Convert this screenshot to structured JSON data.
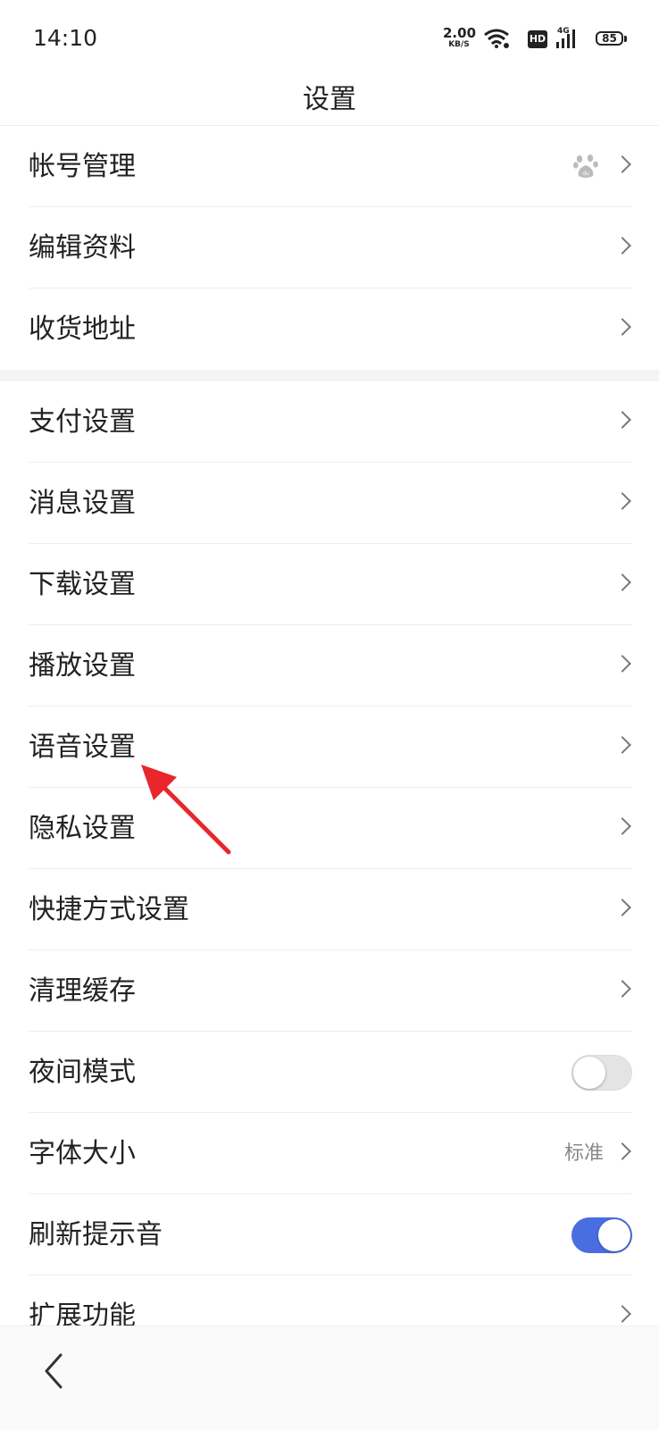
{
  "status_bar": {
    "time": "14:10",
    "net_speed_value": "2.00",
    "net_speed_unit": "KB/S",
    "hd_label": "HD",
    "cell_label": "4G",
    "battery": "85",
    "icons": [
      "wifi-icon",
      "cell-signal-icon",
      "battery-icon"
    ]
  },
  "header": {
    "title": "设置"
  },
  "sections": [
    {
      "items": [
        {
          "label": "帐号管理",
          "trailing_icon": "baidu-paw-icon",
          "chevron": true
        },
        {
          "label": "编辑资料",
          "chevron": true
        },
        {
          "label": "收货地址",
          "chevron": true
        }
      ]
    },
    {
      "items": [
        {
          "label": "支付设置",
          "chevron": true
        },
        {
          "label": "消息设置",
          "chevron": true
        },
        {
          "label": "下载设置",
          "chevron": true
        },
        {
          "label": "播放设置",
          "chevron": true
        },
        {
          "label": "语音设置",
          "chevron": true
        },
        {
          "label": "隐私设置",
          "chevron": true
        },
        {
          "label": "快捷方式设置",
          "chevron": true
        },
        {
          "label": "清理缓存",
          "chevron": true
        },
        {
          "label": "夜间模式",
          "toggle": false
        },
        {
          "label": "字体大小",
          "value": "标准",
          "chevron": true
        },
        {
          "label": "刷新提示音",
          "toggle": true
        },
        {
          "label": "扩展功能",
          "chevron": true
        }
      ]
    }
  ],
  "colors": {
    "toggle_on": "#4a6ee0",
    "toggle_off": "#e4e4e4",
    "annotation_arrow": "#e8262b",
    "divider": "#eeeeee"
  },
  "bottom_bar": {
    "back_icon": "chevron-left-icon"
  }
}
